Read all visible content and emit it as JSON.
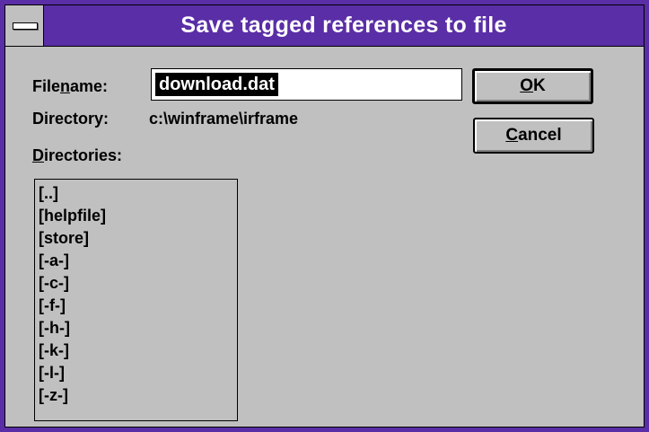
{
  "window": {
    "title": "Save tagged references to file",
    "titlebar_color": "#5a2ea6"
  },
  "filename": {
    "label_before": "File",
    "label_mnemonic": "n",
    "label_after": "ame:",
    "value": "download.dat"
  },
  "directory": {
    "label": "Directory:",
    "path": "c:\\winframe\\irframe"
  },
  "directories": {
    "label_mnemonic": "D",
    "label_after": "irectories:",
    "items": [
      "[..]",
      "[helpfile]",
      "[store]",
      "[-a-]",
      "[-c-]",
      "[-f-]",
      "[-h-]",
      "[-k-]",
      "[-l-]",
      "[-z-]"
    ]
  },
  "buttons": {
    "ok_mnemonic": "O",
    "ok_rest": "K",
    "cancel_mnemonic": "C",
    "cancel_rest": "ancel"
  }
}
